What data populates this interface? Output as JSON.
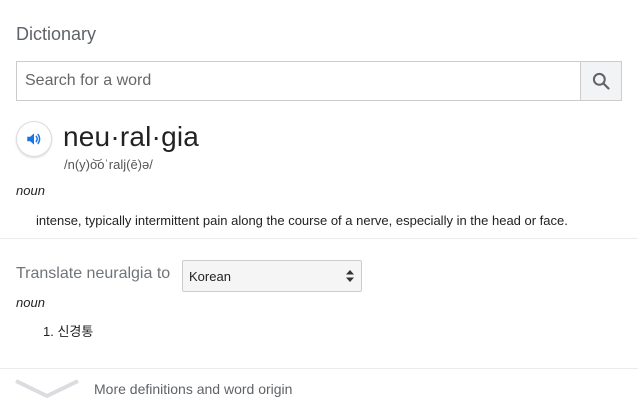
{
  "dictionary": {
    "title": "Dictionary",
    "search": {
      "placeholder": "Search for a word",
      "value": ""
    },
    "icons": {
      "search": "search-icon",
      "audio": "speaker-icon",
      "select_arrows": "up-down-arrows-icon",
      "expand": "chevron-down-icon"
    },
    "entry": {
      "headword": "neu·ral·gia",
      "phonetic": "/n(y)o͝oˈralj(ē)ə/",
      "part_of_speech": "noun",
      "definition": "intense, typically intermittent pain along the course of a nerve, especially in the head or face."
    },
    "translate": {
      "label": "Translate neuralgia to",
      "language": "Korean",
      "part_of_speech": "noun",
      "translations": [
        "1. 신경통"
      ]
    },
    "more": {
      "label": "More definitions and word origin"
    },
    "colors": {
      "accent": "#1a73e8",
      "muted_text": "#5f6368",
      "border": "#cccccc"
    }
  }
}
